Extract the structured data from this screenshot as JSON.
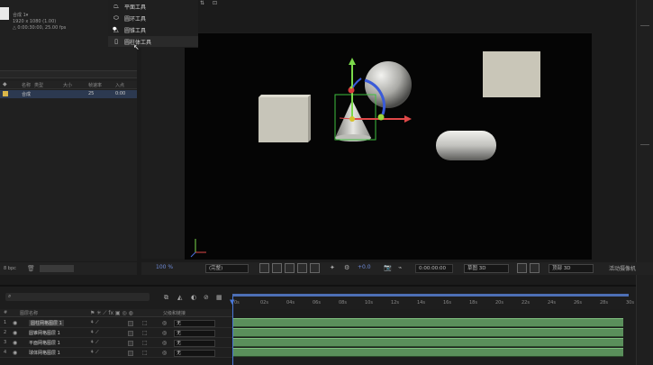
{
  "project": {
    "comp_name": "合成 1▾",
    "comp_res": "1920 x 1080 (1.00)",
    "comp_dur": "△ 0:00:30:00, 25.00 fps",
    "columns": [
      "名称",
      "类型",
      "大小",
      "帧速率",
      "入点"
    ],
    "row": {
      "name": "合成",
      "type": "合成",
      "fps": "25",
      "in": "0:00"
    },
    "bpc": "8 bpc"
  },
  "tool_menu": {
    "items": [
      {
        "label": "平面工具",
        "icon": "plane-tool-icon"
      },
      {
        "label": "圆环工具",
        "icon": "torus-tool-icon"
      },
      {
        "label": "圆锥工具",
        "icon": "cone-tool-icon"
      },
      {
        "label": "圆柱体工具",
        "icon": "cylinder-tool-icon"
      }
    ]
  },
  "viewer": {
    "zoom": "100 %",
    "resolution": "(完整)",
    "exposure": "+0.0",
    "timecode": "0:00:00:00",
    "renderer": "草图 3D",
    "view": "顶部 3D",
    "active_camera": "活动摄像机"
  },
  "timeline": {
    "columns": [
      "#",
      "图层名称",
      "父级和链接"
    ],
    "parent_value": "无",
    "layers": [
      {
        "index": "1",
        "name": "圆柱网格图层 1"
      },
      {
        "index": "2",
        "name": "圆锥网格图层 1"
      },
      {
        "index": "3",
        "name": "平面网格图层 1"
      },
      {
        "index": "4",
        "name": "球体网格图层 1"
      }
    ],
    "ruler": [
      "0s",
      "02s",
      "04s",
      "06s",
      "08s",
      "10s",
      "12s",
      "14s",
      "16s",
      "18s",
      "20s",
      "22s",
      "24s",
      "26s",
      "28s",
      "30s"
    ]
  },
  "colors": {
    "accent": "#4a78d8",
    "layer_bar": "#5a8f5b",
    "selection": "#2c3950"
  }
}
